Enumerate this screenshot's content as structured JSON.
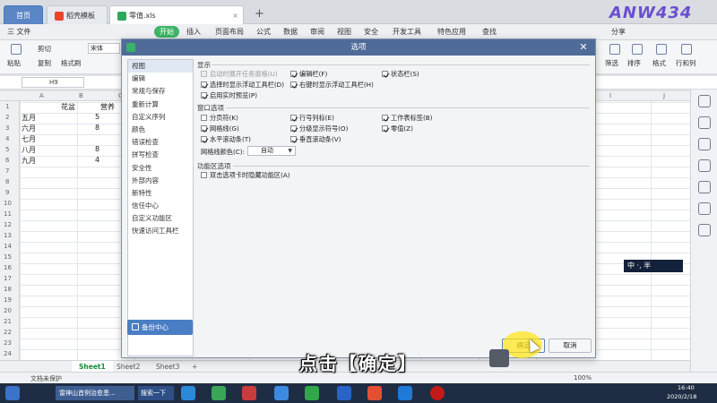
{
  "tabs": [
    {
      "label": "首页"
    },
    {
      "label": "稻壳模板"
    },
    {
      "label": "零值.xls"
    }
  ],
  "brand": "ANW434",
  "menu": {
    "file": "三 文件",
    "start": "开始",
    "items": [
      "插入",
      "页面布局",
      "公式",
      "数据",
      "审阅",
      "视图",
      "安全",
      "开发工具",
      "特色应用",
      "查找"
    ],
    "share": "分享"
  },
  "ribbon": {
    "paste": "粘贴",
    "cut": "剪切",
    "copy": "复制",
    "format_painter": "格式刷",
    "font": "宋体",
    "filter": "筛选",
    "sort": "排序",
    "format": "格式",
    "rows_cols": "行和列"
  },
  "formula_bar": {
    "name_box": "H9"
  },
  "grid": {
    "columns": [
      "A",
      "B",
      "C",
      "D",
      "E",
      "F",
      "G",
      "H",
      "I",
      "J",
      "K",
      "L",
      "M"
    ],
    "rows": [
      "1",
      "2",
      "3",
      "4",
      "5",
      "6",
      "7",
      "8",
      "9",
      "10",
      "11",
      "12",
      "13",
      "14",
      "15",
      "16",
      "17",
      "18",
      "19",
      "20",
      "21",
      "22",
      "23",
      "24"
    ],
    "cells": {
      "B1": "花盆",
      "C1": "营养",
      "A2": "五月",
      "B2": "5",
      "A3": "六月",
      "B3": "8",
      "A4": "七月",
      "A5": "八月",
      "B5": "8",
      "A6": "九月",
      "B6": "4"
    }
  },
  "sheets": [
    "Sheet1",
    "Sheet2",
    "Sheet3"
  ],
  "status": {
    "protect": "文档未保护",
    "zoom": "100%"
  },
  "taskbar": {
    "items": [
      "雷神山首例治愈患...",
      "搜索一下"
    ],
    "time": "16:40",
    "date": "2020/2/18"
  },
  "dialog": {
    "title": "选项",
    "nav": [
      "视图",
      "编辑",
      "常规与保存",
      "重新计算",
      "自定义序列",
      "颜色",
      "错误检查",
      "拼写检查",
      "安全性",
      "外部内容",
      "新特性",
      "信任中心",
      "自定义功能区",
      "快速访问工具栏"
    ],
    "backup": "备份中心",
    "sections": {
      "display": "显示",
      "window": "窗口选项",
      "ribbon": "功能区选项"
    },
    "display_options": [
      {
        "label": "启动时展开任务窗格(U)",
        "checked": false,
        "disabled": true
      },
      {
        "label": "编辑栏(F)",
        "checked": true
      },
      {
        "label": "状态栏(S)",
        "checked": true
      },
      {
        "label": "选择时显示浮动工具栏(D)",
        "checked": true
      },
      {
        "label": "右键时显示浮动工具栏(H)",
        "checked": true
      },
      {
        "label": "启用实时预览(P)",
        "checked": true
      }
    ],
    "window_options": [
      {
        "label": "分页符(K)",
        "checked": false
      },
      {
        "label": "行号列标(E)",
        "checked": true
      },
      {
        "label": "工作表标签(B)",
        "checked": true
      },
      {
        "label": "网格线(G)",
        "checked": true
      },
      {
        "label": "分级显示符号(O)",
        "checked": true
      },
      {
        "label": "零值(Z)",
        "checked": true
      },
      {
        "label": "水平滚动条(T)",
        "checked": true
      },
      {
        "label": "垂直滚动条(V)",
        "checked": true
      }
    ],
    "gridline_color_label": "网格线颜色(C):",
    "gridline_color_value": "自动",
    "ribbon_options": [
      {
        "label": "双击选项卡时隐藏功能区(A)",
        "checked": false
      }
    ],
    "ok": "确定",
    "cancel": "取消"
  },
  "caption": "点击【确定】",
  "ime": "中 ·, 半"
}
